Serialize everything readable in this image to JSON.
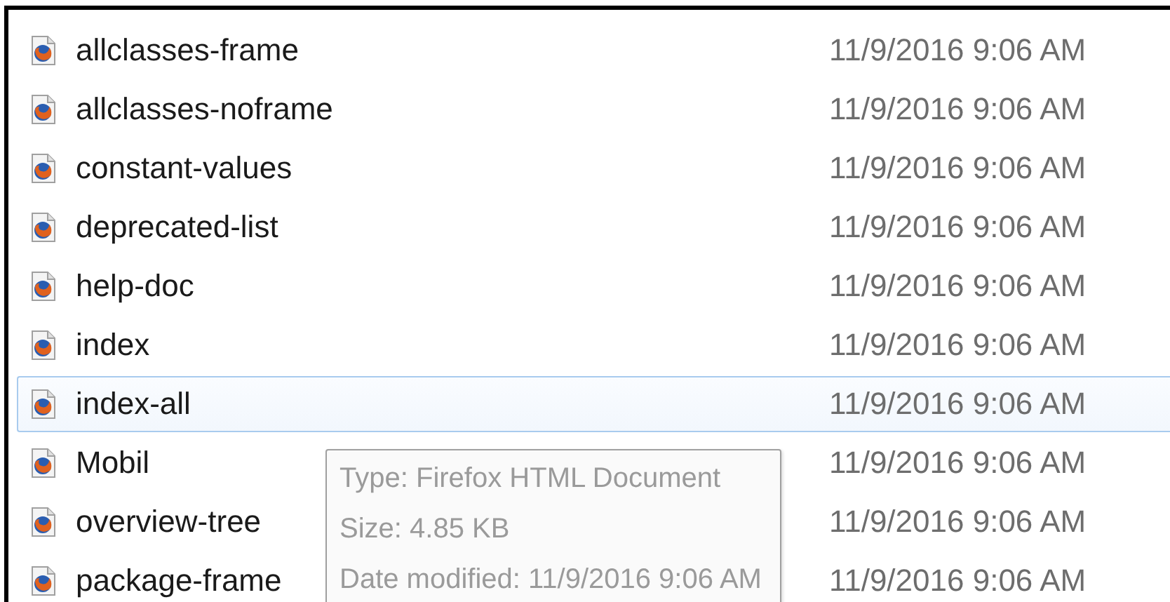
{
  "files": [
    {
      "name": "allclasses-frame",
      "date": "11/9/2016 9:06 AM",
      "hovered": false
    },
    {
      "name": "allclasses-noframe",
      "date": "11/9/2016 9:06 AM",
      "hovered": false
    },
    {
      "name": "constant-values",
      "date": "11/9/2016 9:06 AM",
      "hovered": false
    },
    {
      "name": "deprecated-list",
      "date": "11/9/2016 9:06 AM",
      "hovered": false
    },
    {
      "name": "help-doc",
      "date": "11/9/2016 9:06 AM",
      "hovered": false
    },
    {
      "name": "index",
      "date": "11/9/2016 9:06 AM",
      "hovered": false
    },
    {
      "name": "index-all",
      "date": "11/9/2016 9:06 AM",
      "hovered": true
    },
    {
      "name": "Mobil",
      "date": "11/9/2016 9:06 AM",
      "hovered": false
    },
    {
      "name": "overview-tree",
      "date": "11/9/2016 9:06 AM",
      "hovered": false
    },
    {
      "name": "package-frame",
      "date": "11/9/2016 9:06 AM",
      "hovered": false
    }
  ],
  "tooltip": {
    "lines": [
      "Type: Firefox HTML Document",
      "Size: 4.85 KB",
      "Date modified: 11/9/2016 9:06 AM"
    ]
  }
}
